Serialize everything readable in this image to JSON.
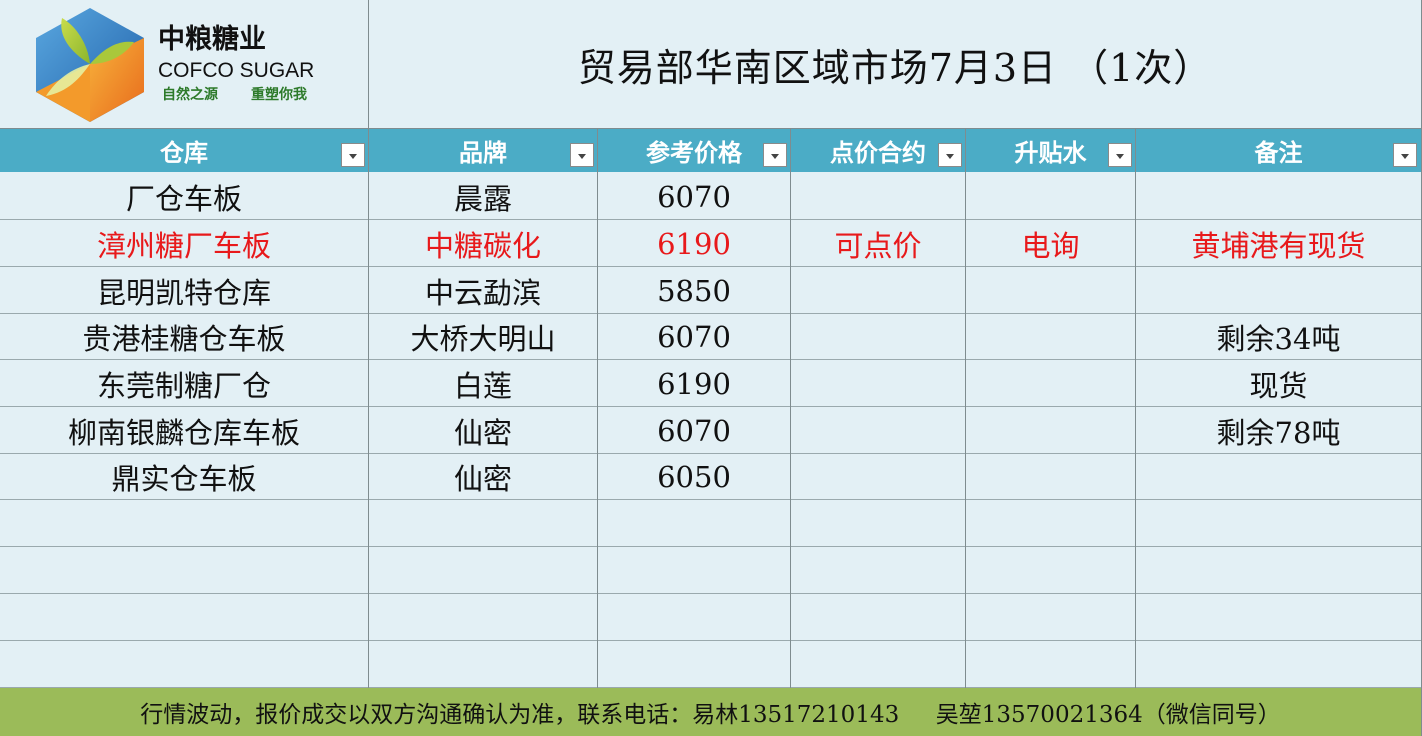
{
  "logo": {
    "cn_name": "中粮糖业",
    "en_name": "COFCO SUGAR",
    "slogan_left": "自然之源",
    "slogan_right": "重塑你我"
  },
  "title": "贸易部华南区域市场7月3日 （1次）",
  "columns": [
    "仓库",
    "品牌",
    "参考价格",
    "点价合约",
    "升贴水",
    "备注"
  ],
  "rows": [
    {
      "warehouse": "厂仓车板",
      "brand": "晨露",
      "price": "6070",
      "contract": "",
      "basis": "",
      "note": "",
      "highlight": false
    },
    {
      "warehouse": "漳州糖厂车板",
      "brand": "中糖碳化",
      "price": "6190",
      "contract": "可点价",
      "basis": "电询",
      "note": "黄埔港有现货",
      "highlight": true
    },
    {
      "warehouse": "昆明凯特仓库",
      "brand": "中云勐滨",
      "price": "5850",
      "contract": "",
      "basis": "",
      "note": "",
      "highlight": false
    },
    {
      "warehouse": "贵港桂糖仓车板",
      "brand": "大桥大明山",
      "price": "6070",
      "contract": "",
      "basis": "",
      "note": "剩余34吨",
      "highlight": false
    },
    {
      "warehouse": "东莞制糖厂仓",
      "brand": "白莲",
      "price": "6190",
      "contract": "",
      "basis": "",
      "note": "现货",
      "highlight": false
    },
    {
      "warehouse": "柳南银麟仓库车板",
      "brand": "仙密",
      "price": "6070",
      "contract": "",
      "basis": "",
      "note": "剩余78吨",
      "highlight": false
    },
    {
      "warehouse": "鼎实仓车板",
      "brand": "仙密",
      "price": "6050",
      "contract": "",
      "basis": "",
      "note": "",
      "highlight": false
    },
    {
      "warehouse": "",
      "brand": "",
      "price": "",
      "contract": "",
      "basis": "",
      "note": "",
      "highlight": false
    },
    {
      "warehouse": "",
      "brand": "",
      "price": "",
      "contract": "",
      "basis": "",
      "note": "",
      "highlight": false
    },
    {
      "warehouse": "",
      "brand": "",
      "price": "",
      "contract": "",
      "basis": "",
      "note": "",
      "highlight": false
    },
    {
      "warehouse": "",
      "brand": "",
      "price": "",
      "contract": "",
      "basis": "",
      "note": "",
      "highlight": false
    }
  ],
  "footer": "行情波动，报价成交以双方沟通确认为准，联系电话：易林13517210143     吴堃13570021364（微信同号）",
  "colors": {
    "header_bg": "#4bacc6",
    "footer_bg": "#9bbb59",
    "sheet_bg": "#e3f0f5",
    "highlight_text": "#e8191b"
  }
}
